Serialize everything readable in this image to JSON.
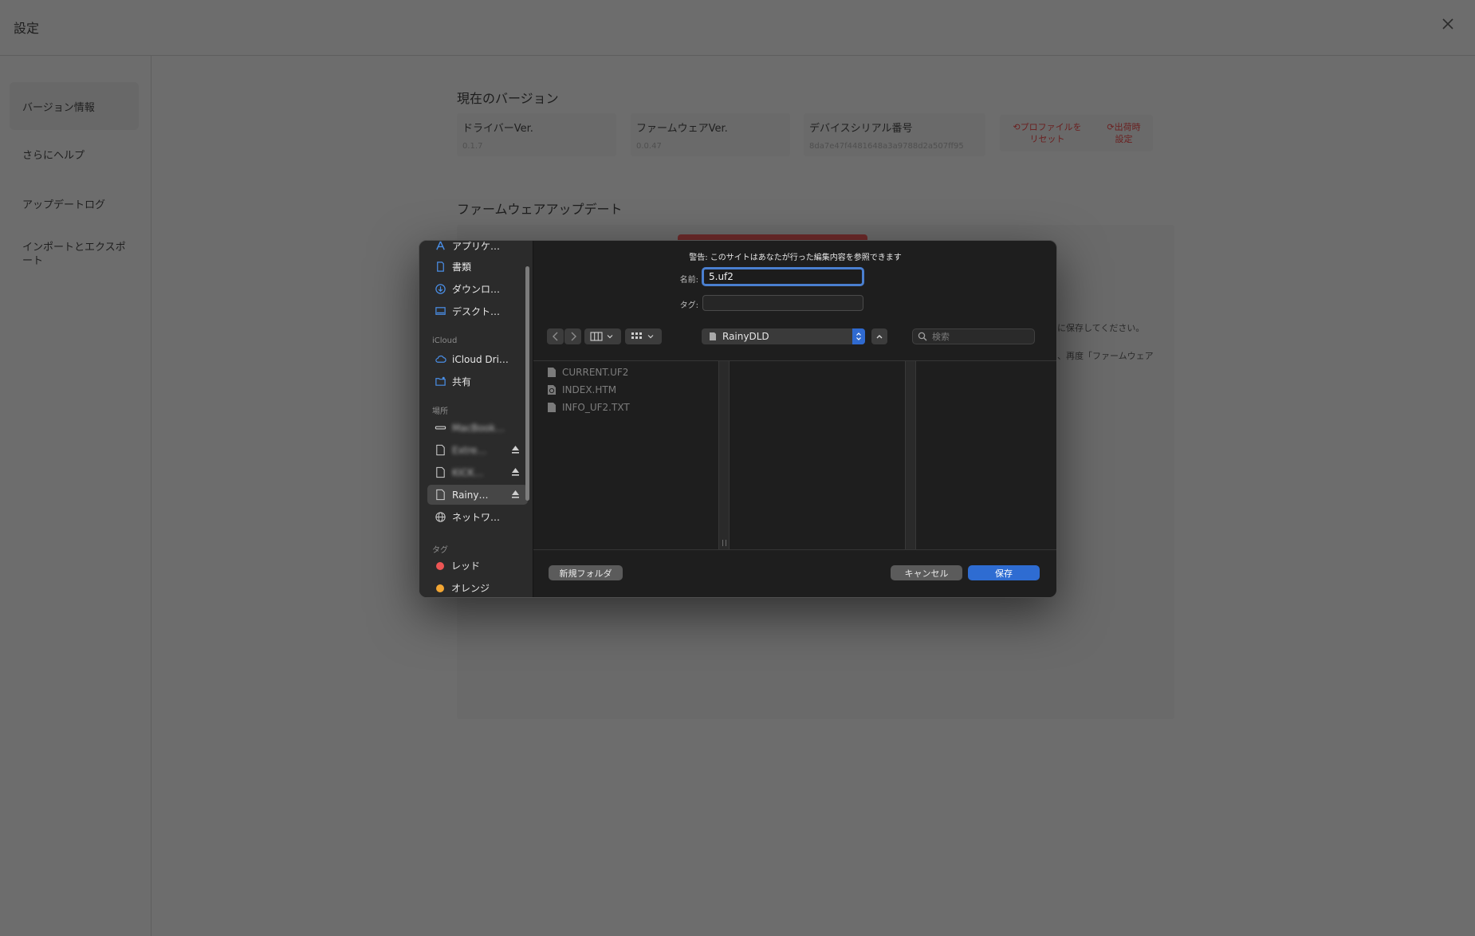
{
  "window": {
    "title": "設定"
  },
  "sidebar": {
    "items": [
      {
        "label": "バージョン情報",
        "active": true
      },
      {
        "label": "さらにヘルプ"
      },
      {
        "label": "アップデートログ"
      },
      {
        "label": "インポートとエクスポート"
      }
    ]
  },
  "version_section": {
    "title": "現在のバージョン",
    "driver": {
      "label": "ドライバーVer.",
      "value": "0.1.7"
    },
    "firmware": {
      "label": "ファームウェアVer.",
      "value": "0.0.47"
    },
    "serial": {
      "label": "デバイスシリアル番号",
      "value": "8da7e47f4481648a3a9788d2a507ff95"
    },
    "reset_profile": "プロファイルをリセット",
    "factory_reset": "出荷時設定"
  },
  "firmware_section": {
    "title": "ファームウェアアップデート",
    "note_1": "に保存してください。",
    "note_2": "、再度「ファームウェア"
  },
  "save_dialog": {
    "warning": "警告: このサイトはあなたが行った編集内容を参照できます",
    "name_label": "名前:",
    "name_value": "5.uf2",
    "tag_label": "タグ:",
    "location": "RainyDLD",
    "search_placeholder": "検索",
    "sidebar": {
      "favorites": [
        {
          "label": "アプリケ…",
          "icon": "applications-icon"
        },
        {
          "label": "書類",
          "icon": "document-icon"
        },
        {
          "label": "ダウンロ…",
          "icon": "downloads-icon"
        },
        {
          "label": "デスクト…",
          "icon": "desktop-icon"
        }
      ],
      "icloud_header": "iCloud",
      "icloud": [
        {
          "label": "iCloud Dri…",
          "icon": "cloud-icon"
        },
        {
          "label": "共有",
          "icon": "shared-folder-icon"
        }
      ],
      "locations_header": "場所",
      "locations": [
        {
          "label": "MacBook…",
          "icon": "drive-icon",
          "blurred": true
        },
        {
          "label": "Extre…",
          "icon": "external-drive-icon",
          "blurred": true,
          "eject": true
        },
        {
          "label": "KICK…",
          "icon": "external-drive-icon",
          "blurred": true,
          "eject": true
        },
        {
          "label": "Rainy…",
          "icon": "external-drive-icon",
          "eject": true,
          "selected": true
        },
        {
          "label": "ネットワ…",
          "icon": "network-icon"
        }
      ],
      "tags_header": "タグ",
      "tags": [
        {
          "label": "レッド",
          "color": "#ec5554"
        },
        {
          "label": "オレンジ",
          "color": "#f3a633"
        }
      ]
    },
    "files": [
      {
        "name": "CURRENT.UF2",
        "icon": "file-icon"
      },
      {
        "name": "INDEX.HTM",
        "icon": "html-file-icon"
      },
      {
        "name": "INFO_UF2.TXT",
        "icon": "file-icon"
      }
    ],
    "new_folder": "新規フォルダ",
    "cancel": "キャンセル",
    "save": "保存"
  },
  "colors": {
    "accent": "#2e6cd2",
    "focus_ring": "#4a7fd0",
    "danger_text": "#6a1f1f"
  }
}
